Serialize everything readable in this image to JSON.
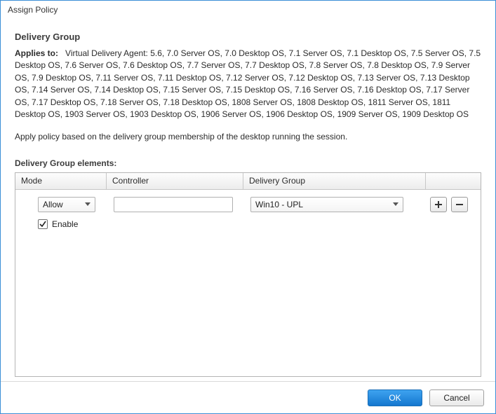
{
  "window_title": "Assign Policy",
  "heading": "Delivery Group",
  "applies_to_label": "Applies to:",
  "applies_to_text": "Virtual Delivery Agent: 5.6, 7.0 Server OS, 7.0 Desktop OS, 7.1 Server OS, 7.1 Desktop OS, 7.5 Server OS, 7.5 Desktop OS, 7.6 Server OS, 7.6 Desktop OS, 7.7 Server OS, 7.7 Desktop OS, 7.8 Server OS, 7.8 Desktop OS, 7.9 Server OS, 7.9 Desktop OS, 7.11 Server OS, 7.11 Desktop OS, 7.12 Server OS, 7.12 Desktop OS, 7.13 Server OS, 7.13 Desktop OS, 7.14 Server OS, 7.14 Desktop OS, 7.15 Server OS, 7.15 Desktop OS, 7.16 Server OS, 7.16 Desktop OS, 7.17 Server OS, 7.17 Desktop OS, 7.18 Server OS, 7.18 Desktop OS, 1808 Server OS, 1808 Desktop OS, 1811 Server OS, 1811 Desktop OS, 1903 Server OS, 1903 Desktop OS, 1906 Server OS, 1906 Desktop OS, 1909 Server OS, 1909 Desktop OS",
  "description": "Apply policy based on the delivery group membership of the desktop running the session.",
  "elements_label": "Delivery Group elements:",
  "columns": {
    "mode": "Mode",
    "controller": "Controller",
    "delivery_group": "Delivery Group",
    "actions": ""
  },
  "row": {
    "mode_value": "Allow",
    "controller_value": "",
    "delivery_group_value": "Win10 - UPL",
    "enable_label": "Enable",
    "enable_checked": true
  },
  "icons": {
    "plus": "+",
    "minus": "−"
  },
  "footer": {
    "ok": "OK",
    "cancel": "Cancel"
  }
}
